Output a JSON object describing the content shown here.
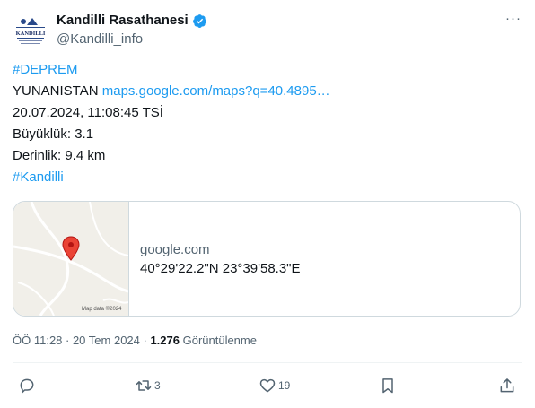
{
  "author": {
    "name": "Kandilli Rasathanesi",
    "handle": "@Kandilli_info",
    "avatar_text": "KANDILLI"
  },
  "more_label": "···",
  "body": {
    "hashtag1": "#DEPREM",
    "location": "YUNANISTAN",
    "map_link": "maps.google.com/maps?q=40.4895…",
    "datetime": "20.07.2024, 11:08:45 TSİ",
    "magnitude": "Büyüklük: 3.1",
    "depth": "Derinlik: 9.4 km",
    "hashtag2": "#Kandilli"
  },
  "card": {
    "domain": "google.com",
    "title": "40°29'22.2\"N 23°39'58.3\"E",
    "map_attribution": "Map data ©2024"
  },
  "meta": {
    "time": "ÖÖ 11:28 · 20 Tem 2024 · ",
    "views_count": "1.276",
    "views_label": " Görüntülenme"
  },
  "actions": {
    "reply_count": "",
    "retweet_count": "3",
    "like_count": "19"
  },
  "colors": {
    "link": "#1d9bf0",
    "secondary_text": "#536471",
    "verified": "#1d9bf0",
    "map_pin": "#ea4335"
  }
}
